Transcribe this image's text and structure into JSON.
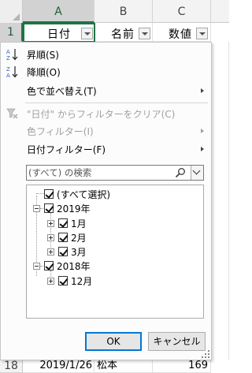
{
  "sheet": {
    "columns": [
      "A",
      "B",
      "C"
    ],
    "header_row_number": "1",
    "header_cells": [
      "日付",
      "名前",
      "数値"
    ],
    "last_row": {
      "number": "18",
      "date": "2019/1/26",
      "name": "松本",
      "value": "169"
    }
  },
  "menu": {
    "sort_asc": "昇順(S)",
    "sort_desc": "降順(O)",
    "sort_by_color": "色で並べ替え(T)",
    "clear_filter": "\"日付\" からフィルターをクリア(C)",
    "color_filter": "色フィルター(I)",
    "date_filter": "日付フィルター(F)",
    "search_placeholder": "(すべて) の検索"
  },
  "tree": {
    "select_all": "(すべて選択)",
    "year_2019": "2019年",
    "months_2019": [
      "1月",
      "2月",
      "3月"
    ],
    "year_2018": "2018年",
    "months_2018": [
      "12月"
    ]
  },
  "buttons": {
    "ok": "OK",
    "cancel": "キャンセル"
  },
  "colors": {
    "excel_green": "#217346",
    "focus_blue": "#0078d7"
  }
}
